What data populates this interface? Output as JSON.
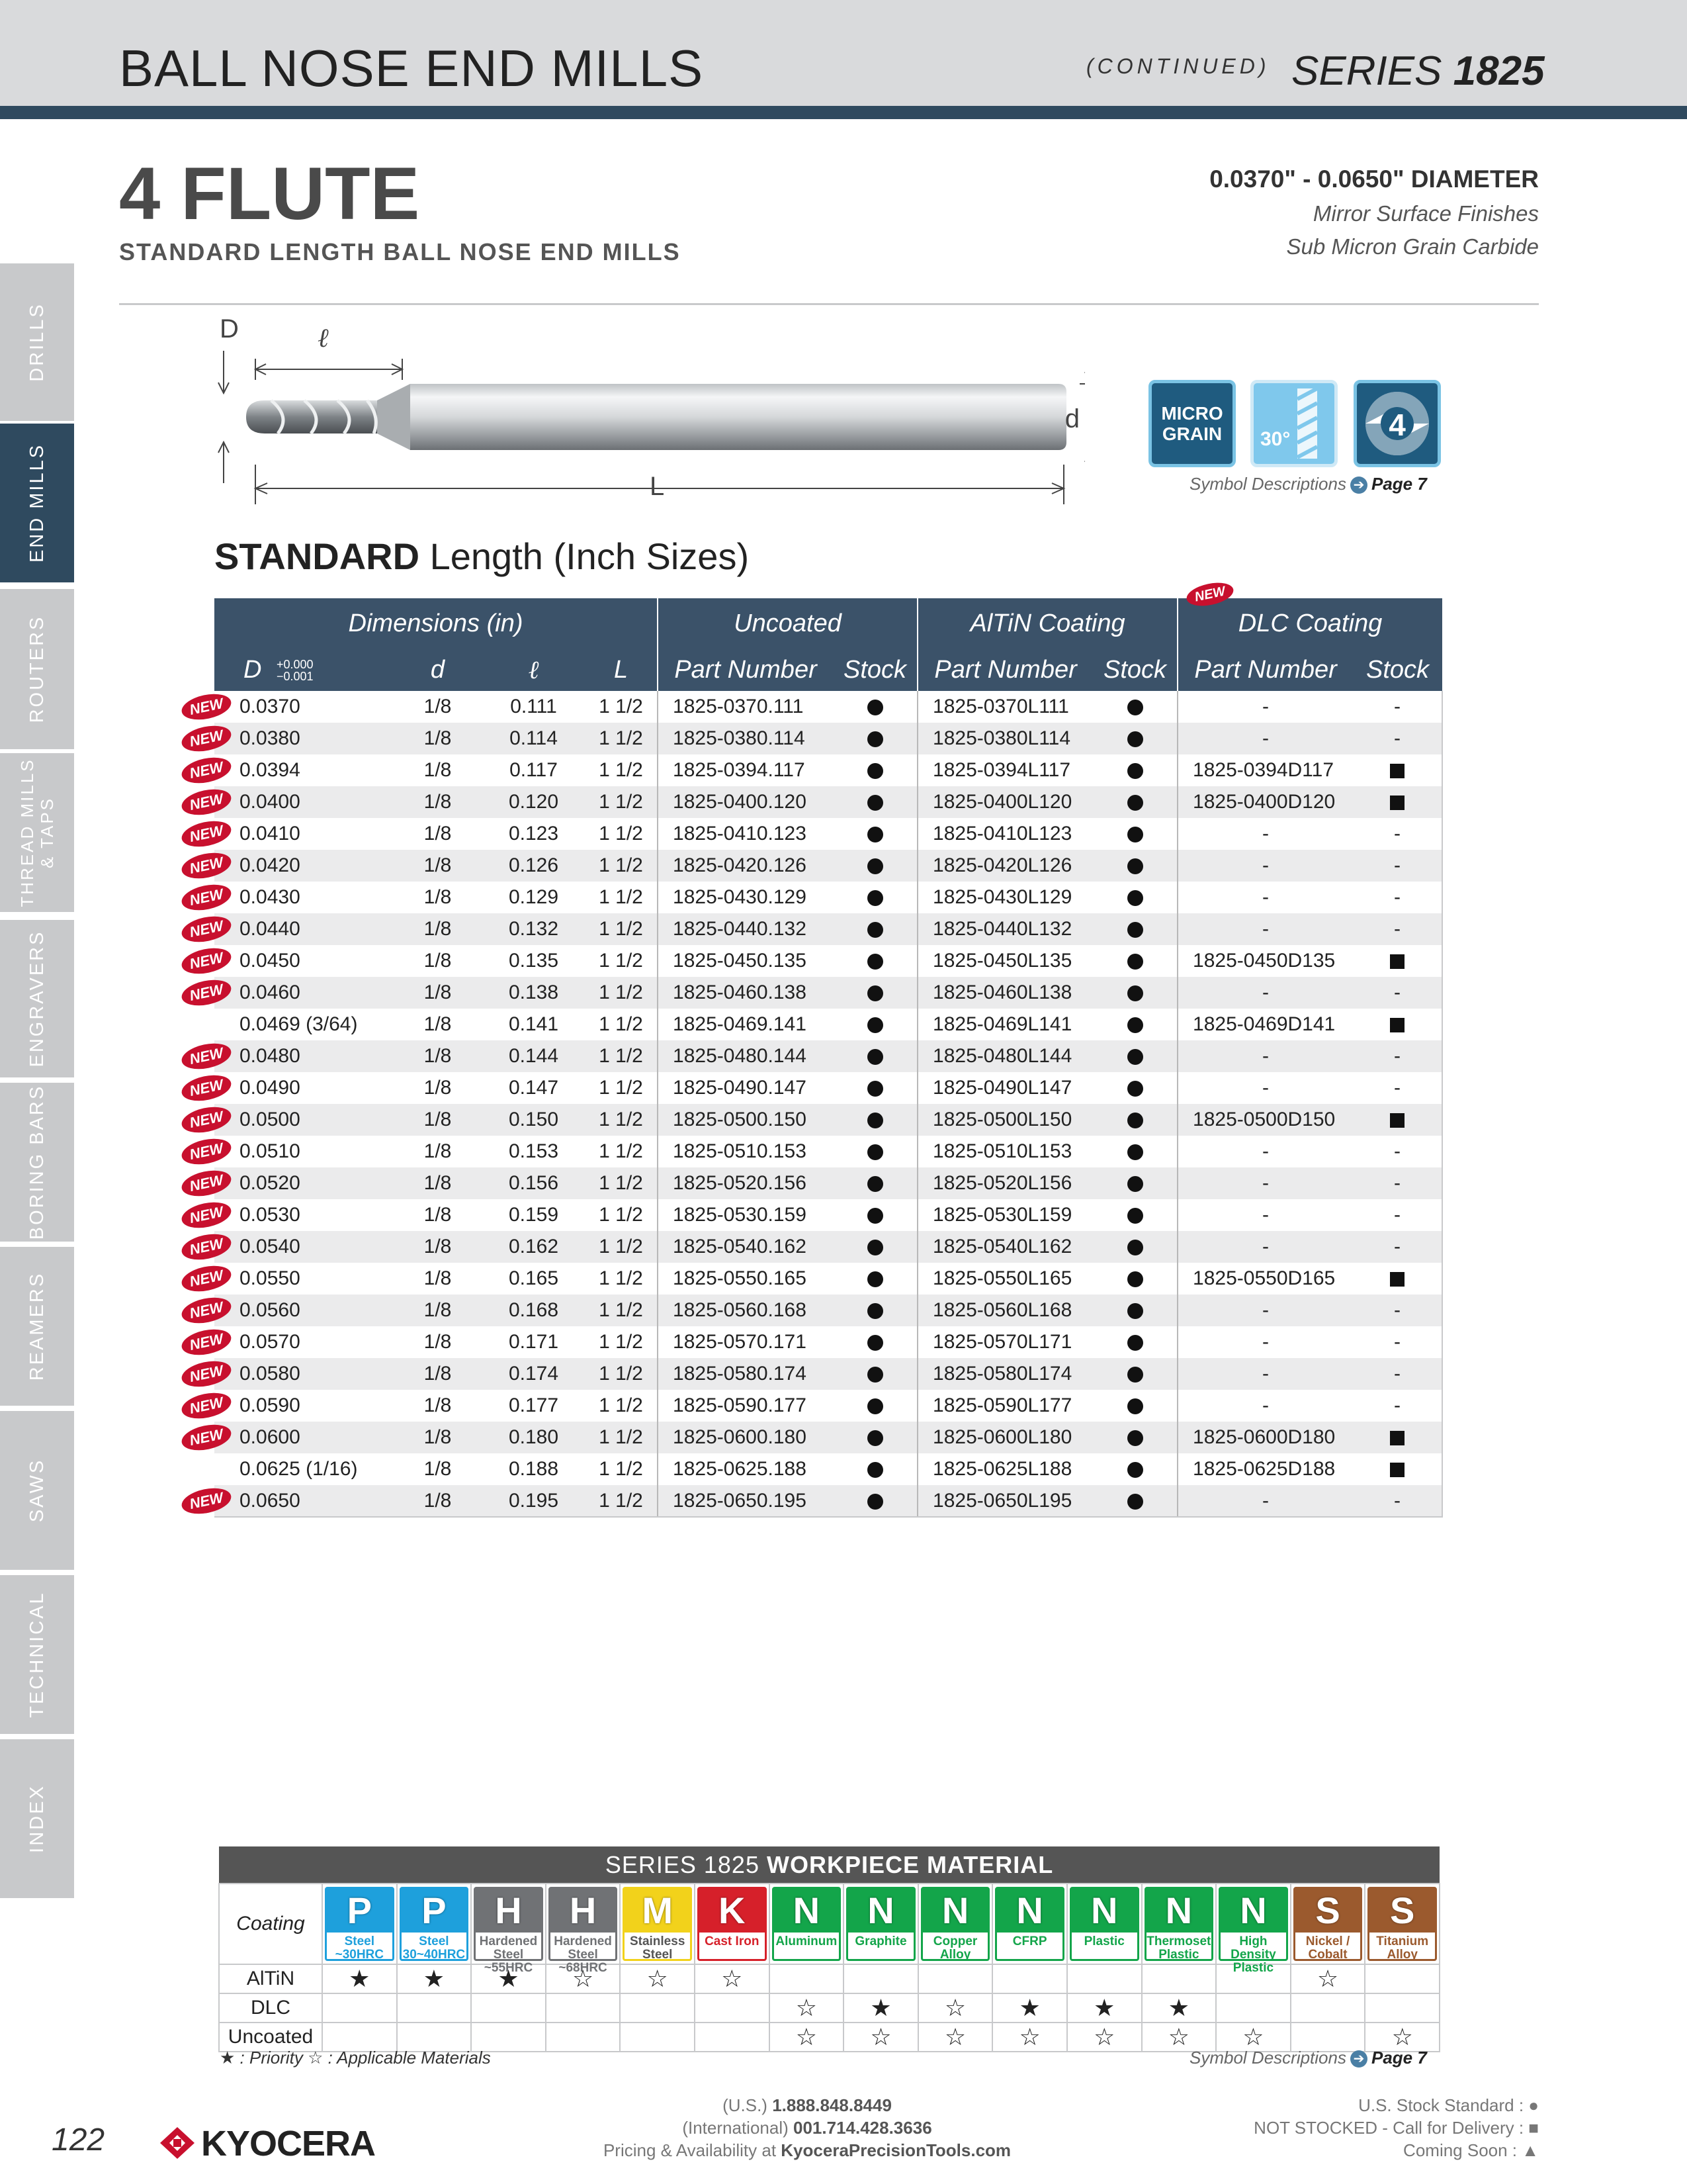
{
  "header": {
    "title": "BALL NOSE END MILLS",
    "continued": "(CONTINUED)",
    "series_prefix": "SERIES ",
    "series_number": "1825"
  },
  "side_tabs": [
    {
      "label": "DRILLS",
      "active": false
    },
    {
      "label": "END MILLS",
      "active": true
    },
    {
      "label": "ROUTERS",
      "active": false
    },
    {
      "label": "THREAD MILLS & TAPS",
      "active": false
    },
    {
      "label": "ENGRAVERS",
      "active": false
    },
    {
      "label": "BORING BARS",
      "active": false
    },
    {
      "label": "REAMERS",
      "active": false
    },
    {
      "label": "SAWS",
      "active": false
    },
    {
      "label": "TECHNICAL",
      "active": false
    },
    {
      "label": "INDEX",
      "active": false
    }
  ],
  "title_block": {
    "flute": "4 FLUTE",
    "subtitle": "STANDARD LENGTH BALL NOSE END MILLS",
    "diameter": "0.0370\" - 0.0650\" DIAMETER",
    "features": [
      "Mirror Surface Finishes",
      "Sub Micron Grain Carbide"
    ]
  },
  "diagram": {
    "labels": {
      "D": "D",
      "l": "ℓ",
      "d": "d",
      "L": "L"
    }
  },
  "symbols": {
    "micro_grain": [
      "MICRO",
      "GRAIN"
    ],
    "helix": "30°",
    "flutes": "4",
    "description": "Symbol Descriptions",
    "page_ref": "Page 7"
  },
  "section": {
    "bold": "STANDARD",
    "rest": " Length (Inch Sizes)"
  },
  "table": {
    "groups": {
      "dimensions": "Dimensions (in)",
      "uncoated": "Uncoated",
      "altin": "AlTiN Coating",
      "dlc": "DLC Coating",
      "dlc_badge": "NEW"
    },
    "columns": {
      "D": "D",
      "D_tol_plus": "+0.000",
      "D_tol_minus": "−0.001",
      "d": "d",
      "l": "ℓ",
      "L": "L",
      "part_number": "Part Number",
      "stock": "Stock"
    },
    "new_label": "NEW",
    "rows": [
      {
        "new": true,
        "D": "0.0370",
        "d": "1/8",
        "l": "0.111",
        "L": "1 1/2",
        "unc_pn": "1825-0370.111",
        "unc_st": "●",
        "alt_pn": "1825-0370L111",
        "alt_st": "●",
        "dlc_pn": "-",
        "dlc_st": "-"
      },
      {
        "new": true,
        "D": "0.0380",
        "d": "1/8",
        "l": "0.114",
        "L": "1 1/2",
        "unc_pn": "1825-0380.114",
        "unc_st": "●",
        "alt_pn": "1825-0380L114",
        "alt_st": "●",
        "dlc_pn": "-",
        "dlc_st": "-"
      },
      {
        "new": true,
        "D": "0.0394",
        "d": "1/8",
        "l": "0.117",
        "L": "1 1/2",
        "unc_pn": "1825-0394.117",
        "unc_st": "●",
        "alt_pn": "1825-0394L117",
        "alt_st": "●",
        "dlc_pn": "1825-0394D117",
        "dlc_st": "■"
      },
      {
        "new": true,
        "D": "0.0400",
        "d": "1/8",
        "l": "0.120",
        "L": "1 1/2",
        "unc_pn": "1825-0400.120",
        "unc_st": "●",
        "alt_pn": "1825-0400L120",
        "alt_st": "●",
        "dlc_pn": "1825-0400D120",
        "dlc_st": "■"
      },
      {
        "new": true,
        "D": "0.0410",
        "d": "1/8",
        "l": "0.123",
        "L": "1 1/2",
        "unc_pn": "1825-0410.123",
        "unc_st": "●",
        "alt_pn": "1825-0410L123",
        "alt_st": "●",
        "dlc_pn": "-",
        "dlc_st": "-"
      },
      {
        "new": true,
        "D": "0.0420",
        "d": "1/8",
        "l": "0.126",
        "L": "1 1/2",
        "unc_pn": "1825-0420.126",
        "unc_st": "●",
        "alt_pn": "1825-0420L126",
        "alt_st": "●",
        "dlc_pn": "-",
        "dlc_st": "-"
      },
      {
        "new": true,
        "D": "0.0430",
        "d": "1/8",
        "l": "0.129",
        "L": "1 1/2",
        "unc_pn": "1825-0430.129",
        "unc_st": "●",
        "alt_pn": "1825-0430L129",
        "alt_st": "●",
        "dlc_pn": "-",
        "dlc_st": "-"
      },
      {
        "new": true,
        "D": "0.0440",
        "d": "1/8",
        "l": "0.132",
        "L": "1 1/2",
        "unc_pn": "1825-0440.132",
        "unc_st": "●",
        "alt_pn": "1825-0440L132",
        "alt_st": "●",
        "dlc_pn": "-",
        "dlc_st": "-"
      },
      {
        "new": true,
        "D": "0.0450",
        "d": "1/8",
        "l": "0.135",
        "L": "1 1/2",
        "unc_pn": "1825-0450.135",
        "unc_st": "●",
        "alt_pn": "1825-0450L135",
        "alt_st": "●",
        "dlc_pn": "1825-0450D135",
        "dlc_st": "■"
      },
      {
        "new": true,
        "D": "0.0460",
        "d": "1/8",
        "l": "0.138",
        "L": "1 1/2",
        "unc_pn": "1825-0460.138",
        "unc_st": "●",
        "alt_pn": "1825-0460L138",
        "alt_st": "●",
        "dlc_pn": "-",
        "dlc_st": "-"
      },
      {
        "new": false,
        "D": "0.0469 (3/64)",
        "d": "1/8",
        "l": "0.141",
        "L": "1 1/2",
        "unc_pn": "1825-0469.141",
        "unc_st": "●",
        "alt_pn": "1825-0469L141",
        "alt_st": "●",
        "dlc_pn": "1825-0469D141",
        "dlc_st": "■"
      },
      {
        "new": true,
        "D": "0.0480",
        "d": "1/8",
        "l": "0.144",
        "L": "1 1/2",
        "unc_pn": "1825-0480.144",
        "unc_st": "●",
        "alt_pn": "1825-0480L144",
        "alt_st": "●",
        "dlc_pn": "-",
        "dlc_st": "-"
      },
      {
        "new": true,
        "D": "0.0490",
        "d": "1/8",
        "l": "0.147",
        "L": "1 1/2",
        "unc_pn": "1825-0490.147",
        "unc_st": "●",
        "alt_pn": "1825-0490L147",
        "alt_st": "●",
        "dlc_pn": "-",
        "dlc_st": "-"
      },
      {
        "new": true,
        "D": "0.0500",
        "d": "1/8",
        "l": "0.150",
        "L": "1 1/2",
        "unc_pn": "1825-0500.150",
        "unc_st": "●",
        "alt_pn": "1825-0500L150",
        "alt_st": "●",
        "dlc_pn": "1825-0500D150",
        "dlc_st": "■"
      },
      {
        "new": true,
        "D": "0.0510",
        "d": "1/8",
        "l": "0.153",
        "L": "1 1/2",
        "unc_pn": "1825-0510.153",
        "unc_st": "●",
        "alt_pn": "1825-0510L153",
        "alt_st": "●",
        "dlc_pn": "-",
        "dlc_st": "-"
      },
      {
        "new": true,
        "D": "0.0520",
        "d": "1/8",
        "l": "0.156",
        "L": "1 1/2",
        "unc_pn": "1825-0520.156",
        "unc_st": "●",
        "alt_pn": "1825-0520L156",
        "alt_st": "●",
        "dlc_pn": "-",
        "dlc_st": "-"
      },
      {
        "new": true,
        "D": "0.0530",
        "d": "1/8",
        "l": "0.159",
        "L": "1 1/2",
        "unc_pn": "1825-0530.159",
        "unc_st": "●",
        "alt_pn": "1825-0530L159",
        "alt_st": "●",
        "dlc_pn": "-",
        "dlc_st": "-"
      },
      {
        "new": true,
        "D": "0.0540",
        "d": "1/8",
        "l": "0.162",
        "L": "1 1/2",
        "unc_pn": "1825-0540.162",
        "unc_st": "●",
        "alt_pn": "1825-0540L162",
        "alt_st": "●",
        "dlc_pn": "-",
        "dlc_st": "-"
      },
      {
        "new": true,
        "D": "0.0550",
        "d": "1/8",
        "l": "0.165",
        "L": "1 1/2",
        "unc_pn": "1825-0550.165",
        "unc_st": "●",
        "alt_pn": "1825-0550L165",
        "alt_st": "●",
        "dlc_pn": "1825-0550D165",
        "dlc_st": "■"
      },
      {
        "new": true,
        "D": "0.0560",
        "d": "1/8",
        "l": "0.168",
        "L": "1 1/2",
        "unc_pn": "1825-0560.168",
        "unc_st": "●",
        "alt_pn": "1825-0560L168",
        "alt_st": "●",
        "dlc_pn": "-",
        "dlc_st": "-"
      },
      {
        "new": true,
        "D": "0.0570",
        "d": "1/8",
        "l": "0.171",
        "L": "1 1/2",
        "unc_pn": "1825-0570.171",
        "unc_st": "●",
        "alt_pn": "1825-0570L171",
        "alt_st": "●",
        "dlc_pn": "-",
        "dlc_st": "-"
      },
      {
        "new": true,
        "D": "0.0580",
        "d": "1/8",
        "l": "0.174",
        "L": "1 1/2",
        "unc_pn": "1825-0580.174",
        "unc_st": "●",
        "alt_pn": "1825-0580L174",
        "alt_st": "●",
        "dlc_pn": "-",
        "dlc_st": "-"
      },
      {
        "new": true,
        "D": "0.0590",
        "d": "1/8",
        "l": "0.177",
        "L": "1 1/2",
        "unc_pn": "1825-0590.177",
        "unc_st": "●",
        "alt_pn": "1825-0590L177",
        "alt_st": "●",
        "dlc_pn": "-",
        "dlc_st": "-"
      },
      {
        "new": true,
        "D": "0.0600",
        "d": "1/8",
        "l": "0.180",
        "L": "1 1/2",
        "unc_pn": "1825-0600.180",
        "unc_st": "●",
        "alt_pn": "1825-0600L180",
        "alt_st": "●",
        "dlc_pn": "1825-0600D180",
        "dlc_st": "■"
      },
      {
        "new": false,
        "D": "0.0625 (1/16)",
        "d": "1/8",
        "l": "0.188",
        "L": "1 1/2",
        "unc_pn": "1825-0625.188",
        "unc_st": "●",
        "alt_pn": "1825-0625L188",
        "alt_st": "●",
        "dlc_pn": "1825-0625D188",
        "dlc_st": "■"
      },
      {
        "new": true,
        "D": "0.0650",
        "d": "1/8",
        "l": "0.195",
        "L": "1 1/2",
        "unc_pn": "1825-0650.195",
        "unc_st": "●",
        "alt_pn": "1825-0650L195",
        "alt_st": "●",
        "dlc_pn": "-",
        "dlc_st": "-"
      }
    ]
  },
  "workpiece": {
    "title_prefix": "SERIES 1825 ",
    "title_bold": "WORKPIECE MATERIAL",
    "coating_label": "Coating",
    "materials": [
      {
        "letter": "P",
        "sub": "Steel ~30HRC",
        "color": "#1ea0dc"
      },
      {
        "letter": "P",
        "sub": "Steel 30~40HRC",
        "color": "#1ea0dc"
      },
      {
        "letter": "H",
        "sub": "Hardened Steel ~55HRC",
        "color": "#707275"
      },
      {
        "letter": "H",
        "sub": "Hardened Steel ~68HRC",
        "color": "#707275"
      },
      {
        "letter": "M",
        "sub": "Stainless Steel",
        "color": "#f2d21b"
      },
      {
        "letter": "K",
        "sub": "Cast Iron",
        "color": "#d6202a"
      },
      {
        "letter": "N",
        "sub": "Aluminum",
        "color": "#13a54a"
      },
      {
        "letter": "N",
        "sub": "Graphite",
        "color": "#13a54a"
      },
      {
        "letter": "N",
        "sub": "Copper Alloy",
        "color": "#13a54a"
      },
      {
        "letter": "N",
        "sub": "CFRP",
        "color": "#13a54a"
      },
      {
        "letter": "N",
        "sub": "Plastic",
        "color": "#13a54a"
      },
      {
        "letter": "N",
        "sub": "Thermoset Plastic",
        "color": "#13a54a"
      },
      {
        "letter": "N",
        "sub": "High Density Plastic",
        "color": "#13a54a"
      },
      {
        "letter": "S",
        "sub": "Nickel / Cobalt",
        "color": "#9b5a2e"
      },
      {
        "letter": "S",
        "sub": "Titanium Alloy",
        "color": "#9b5a2e"
      }
    ],
    "rows": [
      {
        "name": "AlTiN",
        "cells": [
          "★",
          "★",
          "★",
          "☆",
          "☆",
          "☆",
          "",
          "",
          "",
          "",
          "",
          "",
          "",
          "☆",
          ""
        ]
      },
      {
        "name": "DLC",
        "cells": [
          "",
          "",
          "",
          "",
          "",
          "",
          "☆",
          "★",
          "☆",
          "★",
          "★",
          "★",
          "",
          "",
          ""
        ]
      },
      {
        "name": "Uncoated",
        "cells": [
          "",
          "",
          "",
          "",
          "",
          "",
          "☆",
          "☆",
          "☆",
          "☆",
          "☆",
          "☆",
          "☆",
          "",
          "☆"
        ]
      }
    ],
    "legend": "★ : Priority  ☆ : Applicable Materials",
    "symbol_description": "Symbol Descriptions",
    "page_ref": "Page 7"
  },
  "footer": {
    "page_number": "122",
    "brand": "KYOCERA",
    "us_prefix": "(U.S.) ",
    "us_phone": "1.888.848.8449",
    "intl_prefix": "(International) ",
    "intl_phone": "001.714.428.3636",
    "pricing_prefix": "Pricing & Availability at ",
    "pricing_site": "KyoceraPrecisionTools.com",
    "legend": [
      "U.S. Stock Standard : ●",
      "NOT STOCKED - Call for Delivery : ■",
      "Coming Soon : ▲"
    ]
  }
}
